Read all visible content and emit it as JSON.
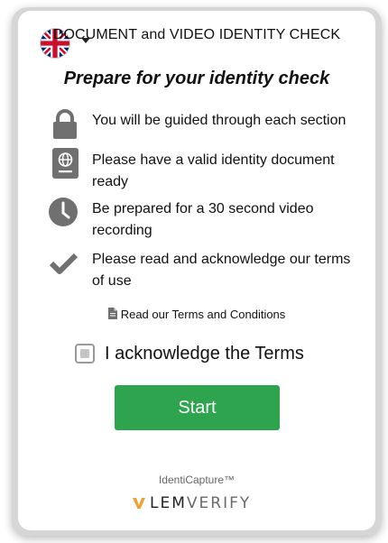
{
  "header": {
    "title": "DOCUMENT and VIDEO IDENTITY CHECK",
    "language_icon": "uk-flag-icon"
  },
  "heading": "Prepare for your identity check",
  "steps": [
    {
      "icon": "lock-icon",
      "text": "You will be guided through each section"
    },
    {
      "icon": "passport-icon",
      "text": "Please have a valid identity document ready"
    },
    {
      "icon": "clock-icon",
      "text": "Be prepared for a 30 second video recording"
    },
    {
      "icon": "checkmark-icon",
      "text": "Please read and acknowledge our terms of use"
    }
  ],
  "terms_link": {
    "icon": "document-icon",
    "label": "Read our Terms and Conditions"
  },
  "acknowledge": {
    "label": "I acknowledge the Terms",
    "checked": false
  },
  "start_button": {
    "label": "Start",
    "color": "#2ea44f"
  },
  "footer": {
    "brand": "IdentiCapture™",
    "logo_part1": "LEM",
    "logo_part2": "VERIFY",
    "logo_accent": "#f0a030"
  }
}
